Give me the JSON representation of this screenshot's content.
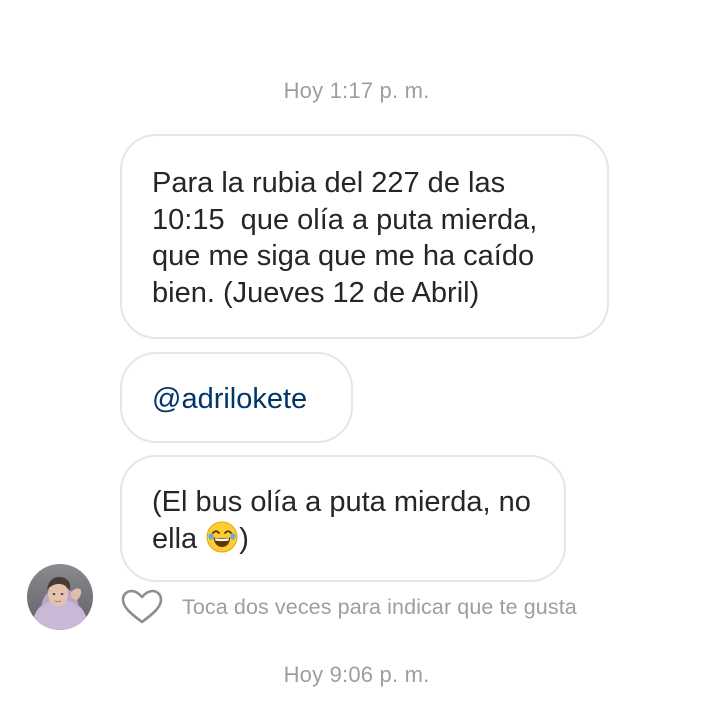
{
  "thread": {
    "timestamp_top": "Hoy 1:17 p. m.",
    "timestamp_bottom": "Hoy 9:06 p. m."
  },
  "messages": [
    {
      "lines": [
        "Para la rubia del 227 de las",
        "10:15  que olía a puta mierda,",
        "que me siga que me ha caído",
        "bien. (Jueves 12 de Abril)"
      ]
    },
    {
      "mention": "@adrilokete",
      "link_color": "#003569"
    },
    {
      "line_1": "(El bus olía a puta mierda, no",
      "line_2_before_emoji": "ella ",
      "emoji": "face-with-tears-of-joy-icon",
      "line_2_after_emoji": ")"
    }
  ],
  "sender": {
    "avatar": "user-avatar-photo"
  },
  "like": {
    "icon": "heart-outline-icon",
    "hint": "Toca dos veces para indicar que te gusta"
  },
  "colors": {
    "bubble_border": "#e6e6e6",
    "text": "#262626",
    "muted": "#9e9e9e"
  }
}
